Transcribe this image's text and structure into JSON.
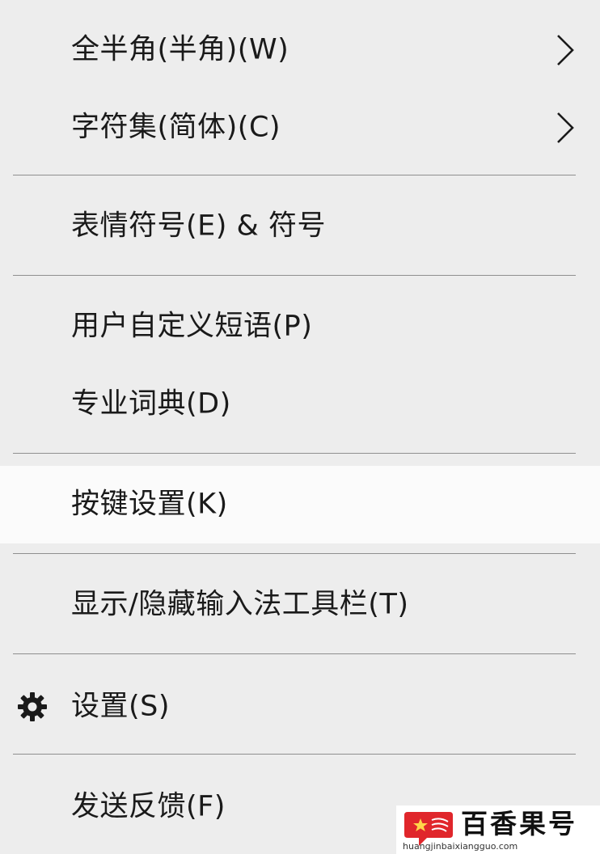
{
  "menu": {
    "items": [
      {
        "label": "全半角(半角)(W)",
        "submenu_icon": "chevron-right-icon"
      },
      {
        "label": "字符集(简体)(C)",
        "submenu_icon": "chevron-right-icon"
      },
      {
        "label": "表情符号(E) & 符号"
      },
      {
        "label": "用户自定义短语(P)"
      },
      {
        "label": "专业词典(D)"
      },
      {
        "label": "按键设置(K)",
        "state": "hovered"
      },
      {
        "label": "显示/隐藏输入法工具栏(T)"
      },
      {
        "label": "设置(S)",
        "icon": "gear-icon"
      },
      {
        "label": "发送反馈(F)"
      }
    ]
  },
  "watermark": {
    "name": "百香果号",
    "url": "huangjinbaixiangguo.com"
  },
  "colors": {
    "menu_background": "#ededed",
    "hover_background": "#fbfbfb",
    "separator": "#8f8f8f",
    "text": "#1a1a1a",
    "logo_red": "#e0262b"
  }
}
